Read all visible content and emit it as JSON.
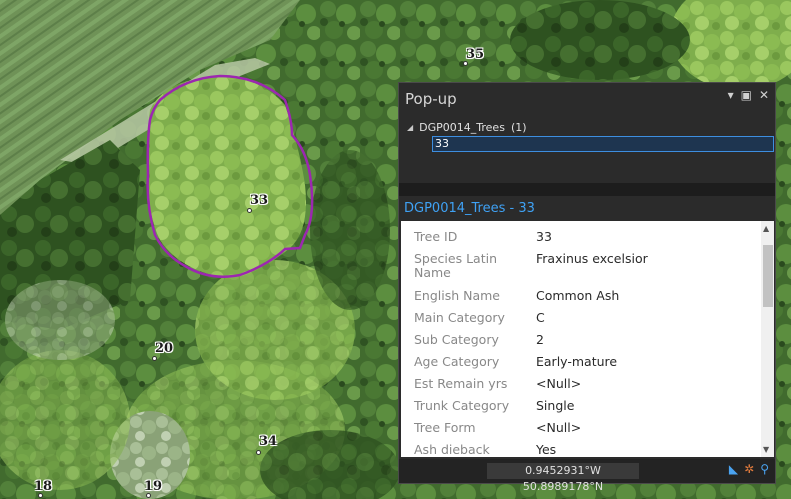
{
  "map": {
    "tree_labels": [
      {
        "id": "35",
        "name": "tree-label-35"
      },
      {
        "id": "33",
        "name": "tree-label-33"
      },
      {
        "id": "20",
        "name": "tree-label-20"
      },
      {
        "id": "34",
        "name": "tree-label-34"
      },
      {
        "id": "18",
        "name": "tree-label-18"
      },
      {
        "id": "19",
        "name": "tree-label-19"
      }
    ],
    "highlight_color": "#9c27b0"
  },
  "popup": {
    "title": "Pop-up",
    "controls": {
      "menu_icon": "chevron-down-icon",
      "restore_icon": "restore-icon",
      "close_icon": "close-icon"
    },
    "layer": {
      "name": "DGP0014_Trees",
      "count": "(1)"
    },
    "selected_feature": "33",
    "feature_title": "DGP0014_Trees - 33",
    "attributes": [
      {
        "key": "Tree ID",
        "value": "33"
      },
      {
        "key": "Species Latin Name",
        "value": "Fraxinus excelsior"
      },
      {
        "key": "English Name",
        "value": "Common Ash"
      },
      {
        "key": "Main Category",
        "value": "C"
      },
      {
        "key": "Sub Category",
        "value": "2"
      },
      {
        "key": "Age Category",
        "value": "Early-mature"
      },
      {
        "key": "Est Remain yrs",
        "value": "<Null>"
      },
      {
        "key": "Trunk Category",
        "value": "Single"
      },
      {
        "key": "Tree Form",
        "value": "<Null>"
      },
      {
        "key": "Ash dieback",
        "value": "Yes"
      }
    ],
    "status": {
      "coordinates": "0.9452931°W 50.8989178°N",
      "icons": [
        "select-icon",
        "navigate-icon",
        "search-icon"
      ]
    },
    "accent_color": "#3fa2f5"
  }
}
